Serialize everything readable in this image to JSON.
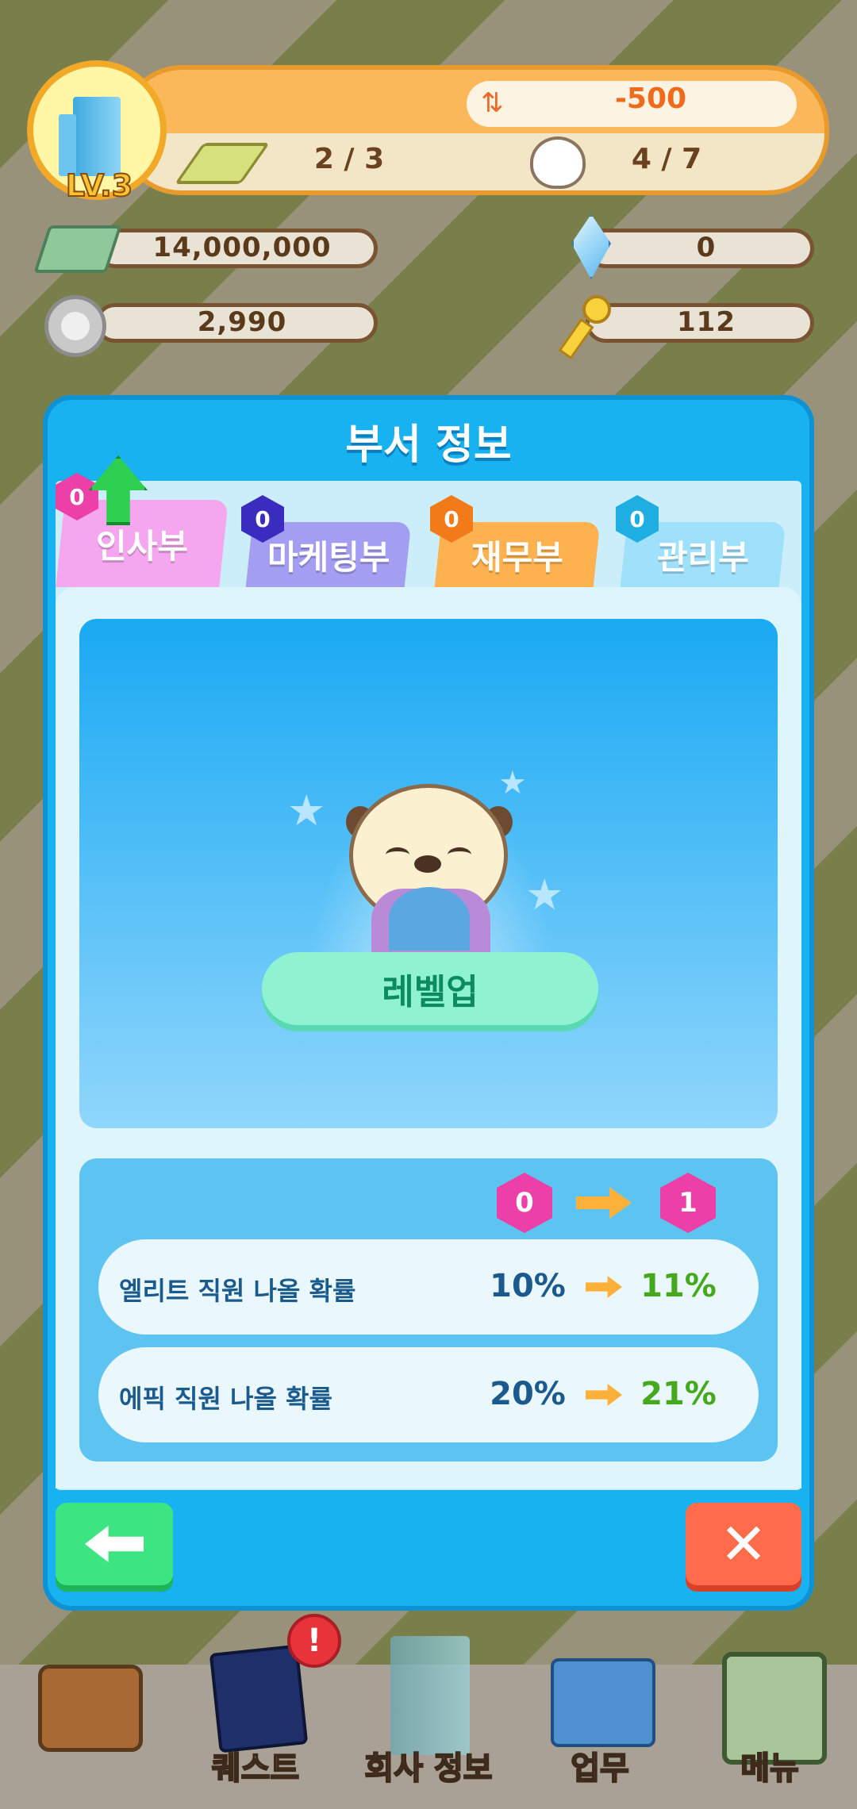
{
  "hud": {
    "level": "LV.3",
    "balance_change": "-500",
    "land": "2 / 3",
    "staff": "4 / 7",
    "money": "14,000,000",
    "gems": "0",
    "coins": "2,990",
    "keys": "112"
  },
  "dialog": {
    "title": "부서 정보",
    "tabs": [
      {
        "label": "인사부",
        "level": "0",
        "color": "#f4a7ee"
      },
      {
        "label": "마케팅부",
        "level": "0",
        "color": "#a49ef2"
      },
      {
        "label": "재무부",
        "level": "0",
        "color": "#fdb24f"
      },
      {
        "label": "관리부",
        "level": "0",
        "color": "#9fe0fb"
      }
    ],
    "levelup_label": "레벨업",
    "level_from": "0",
    "level_to": "1",
    "stats": [
      {
        "label": "엘리트 직원 나올 확률",
        "from": "10%",
        "to": "11%"
      },
      {
        "label": "에픽 직원 나올 확률",
        "from": "20%",
        "to": "21%"
      }
    ],
    "close_symbol": "✕"
  },
  "nav": {
    "items": [
      {
        "label": "",
        "icon": "briefcase-icon"
      },
      {
        "label": "퀘스트",
        "icon": "quest-book-icon",
        "badge": "!"
      },
      {
        "label": "회사 정보",
        "icon": "company-building-icon"
      },
      {
        "label": "업무",
        "icon": "task-folder-icon"
      },
      {
        "label": "메뉴",
        "icon": "menu-icon"
      }
    ]
  }
}
